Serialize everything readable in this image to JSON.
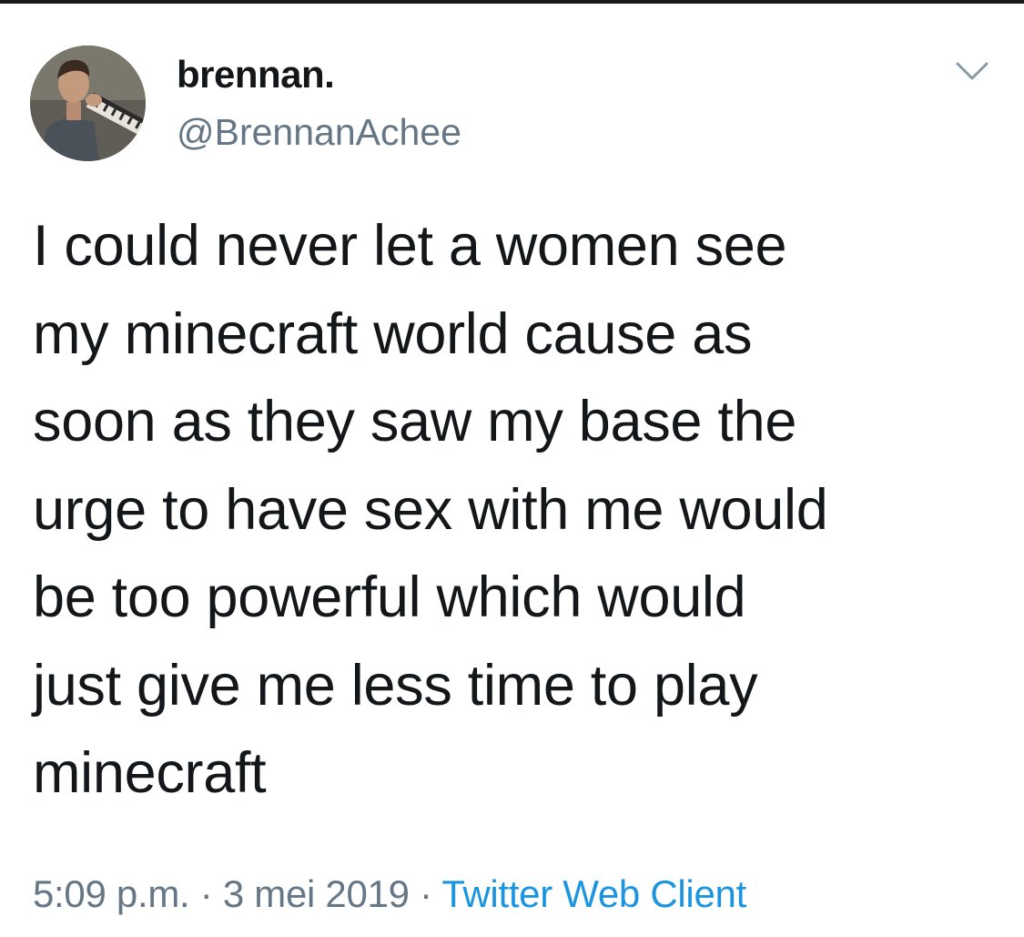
{
  "tweet": {
    "author": {
      "display_name": "brennan.",
      "handle": "@BrennanAchee",
      "avatar_icon": "profile-photo"
    },
    "menu_icon": "chevron-down-icon",
    "text_lines": [
      "I could never let a women see",
      "my minecraft world cause as",
      "soon as they saw my base the",
      "urge to have sex with me would",
      "be too powerful which would",
      "just give me less time to play",
      "minecraft"
    ],
    "time": "5:09 p.m.",
    "separator": "·",
    "date": "3 mei 2019",
    "source": "Twitter Web Client"
  },
  "colors": {
    "text": "#14171a",
    "secondary": "#657786",
    "link": "#1b95e0",
    "background": "#ffffff"
  }
}
